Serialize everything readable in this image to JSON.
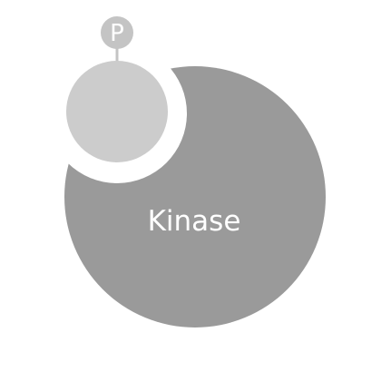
{
  "diagram": {
    "kinase_label": "Kinase",
    "phosphate_label": "P"
  },
  "colors": {
    "background": "#ffffff",
    "kinase_body": "#9a9a9a",
    "substrate": "#cccccc",
    "phosphate_tag": "#c4c4c4",
    "phosphate_text": "#ffffff",
    "kinase_text": "#ffffff"
  }
}
